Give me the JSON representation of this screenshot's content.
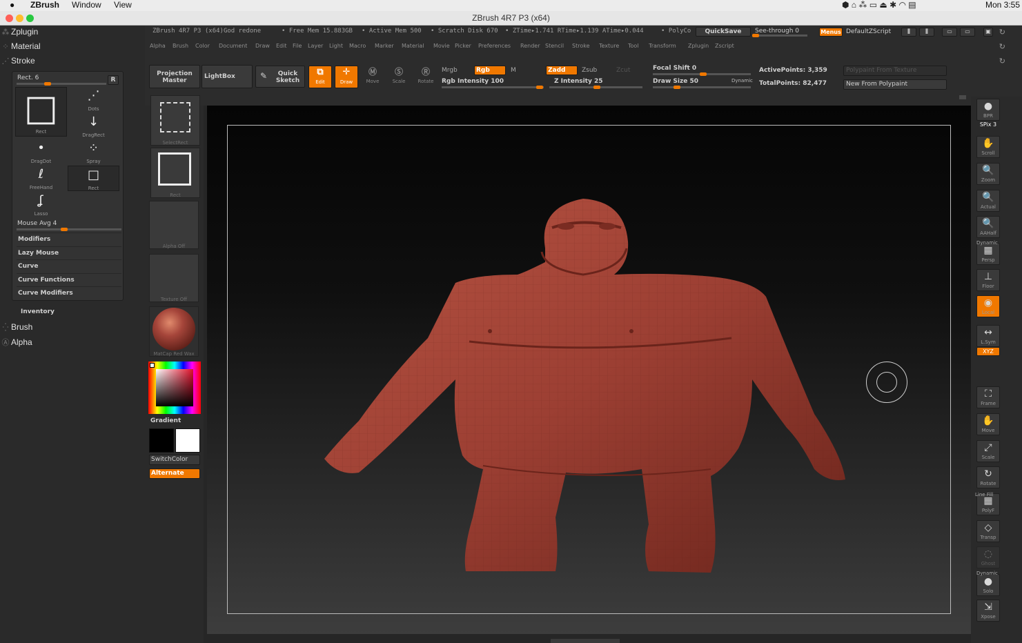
{
  "mac": {
    "apple": "",
    "app": "ZBrush",
    "window": "Window",
    "view": "View",
    "clock": "Mon 3:55"
  },
  "window": {
    "title": "ZBrush 4R7 P3 (x64)"
  },
  "info": {
    "app_info": "ZBrush 4R7 P3 (x64)God redone",
    "free_mem": "• Free Mem 15.883GB",
    "active_mem": "• Active Mem 500",
    "scratch": "• Scratch Disk 670",
    "ztime": "• ZTime▸1.741 RTime▸1.139 ATime▸0.044",
    "polyco": "• PolyCo",
    "quicksave": "QuickSave",
    "seethrough": "See-through  0",
    "menus": "Menus",
    "script": "DefaultZScript"
  },
  "menu": [
    "Alpha",
    "Brush",
    "Color",
    "Document",
    "Draw",
    "Edit",
    "File",
    "Layer",
    "Light",
    "Macro",
    "Marker",
    "Material",
    "Movie",
    "Picker",
    "Preferences",
    "Render",
    "Stencil",
    "Stroke",
    "Texture",
    "Tool",
    "Transform",
    "Zplugin",
    "Zscript"
  ],
  "toolbar": {
    "projection": "Projection Master",
    "lightbox": "LightBox",
    "quicksketch": "Quick Sketch",
    "edit": "Edit",
    "draw": "Draw",
    "move": "Move",
    "scale": "Scale",
    "rotate": "Rotate",
    "mrgb": "Mrgb",
    "rgb": "Rgb",
    "m": "M",
    "rgb_intensity": "Rgb Intensity 100",
    "zadd": "Zadd",
    "zsub": "Zsub",
    "zcut": "Zcut",
    "z_intensity": "Z Intensity 25",
    "focal": "Focal Shift 0",
    "draw_size": "Draw Size 50",
    "dynamic": "Dynamic",
    "active_points": "ActivePoints: 3,359",
    "total_points": "TotalPoints: 82,477",
    "polypaint_from_texture": "Polypaint From Texture",
    "new_from_polypaint": "New From Polypaint"
  },
  "left": {
    "zplugin": "Zplugin",
    "material": "Material",
    "stroke": "Stroke",
    "stroke_current": "Rect. 6",
    "stroke_r": "R",
    "strokes": [
      {
        "label": "Rect",
        "glyph": "□"
      },
      {
        "label": "Dots",
        "glyph": "⋰"
      },
      {
        "label": "DragRect",
        "glyph": "↓"
      },
      {
        "label": "DragDot",
        "glyph": "•"
      },
      {
        "label": "Spray",
        "glyph": "⁘"
      },
      {
        "label": "FreeHand",
        "glyph": "ℓ"
      },
      {
        "label": "Rect",
        "glyph": "□"
      },
      {
        "label": "Lasso",
        "glyph": "ʆ"
      }
    ],
    "mouse_avg": "Mouse Avg 4",
    "subs": [
      "Modifiers",
      "Lazy Mouse",
      "Curve",
      "Curve Functions",
      "Curve Modifiers"
    ],
    "inventory": "Inventory",
    "brush": "Brush",
    "alpha": "Alpha"
  },
  "tools": {
    "selectrect": "SelectRect",
    "rect": "Rect",
    "alpha_off": "Alpha Off",
    "texture_off": "Texture Off",
    "matcap": "MatCap Red Wax",
    "gradient": "Gradient",
    "switchcolor": "SwitchColor",
    "alternate": "Alternate"
  },
  "right": [
    {
      "label": "BPR",
      "glyph": "●"
    },
    {
      "label": "SPix 3",
      "glyph": ""
    },
    {
      "label": "Scroll",
      "glyph": "✋"
    },
    {
      "label": "Zoom",
      "glyph": "🔍"
    },
    {
      "label": "Actual",
      "glyph": "🔍"
    },
    {
      "label": "AAHalf",
      "glyph": "🔍"
    },
    {
      "label": "Persp",
      "glyph": "▦"
    },
    {
      "label": "Floor",
      "glyph": "⊥"
    },
    {
      "label": "Local",
      "glyph": "◉"
    },
    {
      "label": "L.Sym",
      "glyph": "↔"
    },
    {
      "label": "XYZ",
      "glyph": ""
    },
    {
      "label": "Frame",
      "glyph": "⛶"
    },
    {
      "label": "Move",
      "glyph": "✋"
    },
    {
      "label": "Scale",
      "glyph": "⤢"
    },
    {
      "label": "Rotate",
      "glyph": "↻"
    },
    {
      "label": "PolyF",
      "glyph": "▦"
    },
    {
      "label": "Transp",
      "glyph": "◇"
    },
    {
      "label": "Ghost",
      "glyph": "◌"
    },
    {
      "label": "Solo",
      "glyph": "●"
    },
    {
      "label": "Xpose",
      "glyph": "⇲"
    }
  ],
  "right_extra": {
    "dynamic": "Dynamic",
    "linefill": "Line Fill"
  },
  "colors": {
    "accent": "#f07800",
    "model": "#a5453a"
  }
}
